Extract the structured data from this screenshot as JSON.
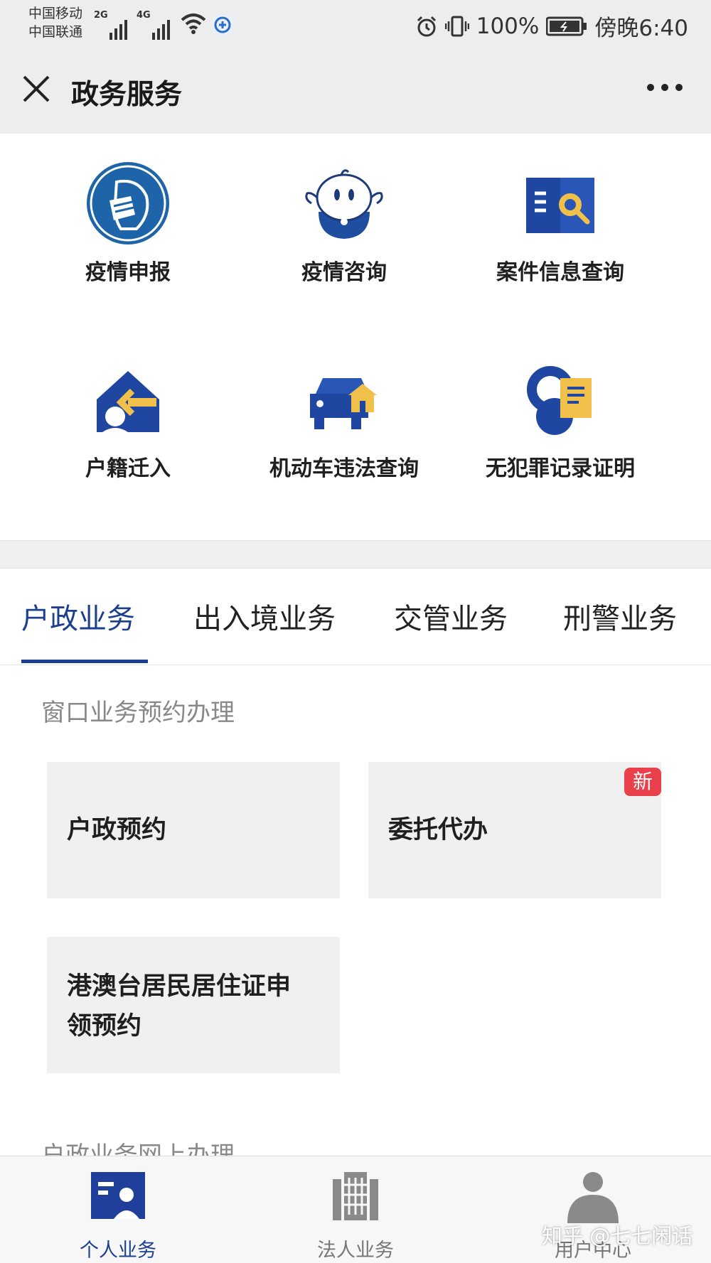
{
  "status_bar": {
    "carrier_1": "中国移动",
    "carrier_2": "中国联通",
    "net_1": "2G",
    "net_2": "4G",
    "battery": "100%",
    "time": "傍晚6:40"
  },
  "title_bar": {
    "title": "政务服务"
  },
  "quick_items": [
    {
      "label": "疫情申报",
      "icon": "mask-icon"
    },
    {
      "label": "疫情咨询",
      "icon": "mascot-icon"
    },
    {
      "label": "案件信息查询",
      "icon": "book-search-icon"
    },
    {
      "label": "户籍迁入",
      "icon": "house-arrow-icon"
    },
    {
      "label": "机动车违法查询",
      "icon": "car-house-icon"
    },
    {
      "label": "无犯罪记录证明",
      "icon": "handcuffs-document-icon"
    }
  ],
  "tabs": [
    {
      "label": "户政业务",
      "active": true
    },
    {
      "label": "出入境业务",
      "active": false
    },
    {
      "label": "交管业务",
      "active": false
    },
    {
      "label": "刑警业务",
      "active": false
    }
  ],
  "section": {
    "title": "窗口业务预约办理",
    "cards": [
      {
        "label": "户政预约"
      },
      {
        "label": "委托代办",
        "badge": "新"
      },
      {
        "label_line1": "港澳台居民居住证申",
        "label_line2": "领预约"
      }
    ],
    "next_title": "户政业务网上办理"
  },
  "bottom_nav": [
    {
      "label": "个人业务",
      "icon": "person-card-icon",
      "active": true
    },
    {
      "label": "法人业务",
      "icon": "building-icon",
      "active": false
    },
    {
      "label": "用户中心",
      "icon": "user-icon",
      "active": false
    }
  ],
  "watermark": "知乎 @七七闲话",
  "colors": {
    "accent": "#1c3f8f",
    "icon_gold": "#f0c04a",
    "badge_red": "#e8414c"
  }
}
